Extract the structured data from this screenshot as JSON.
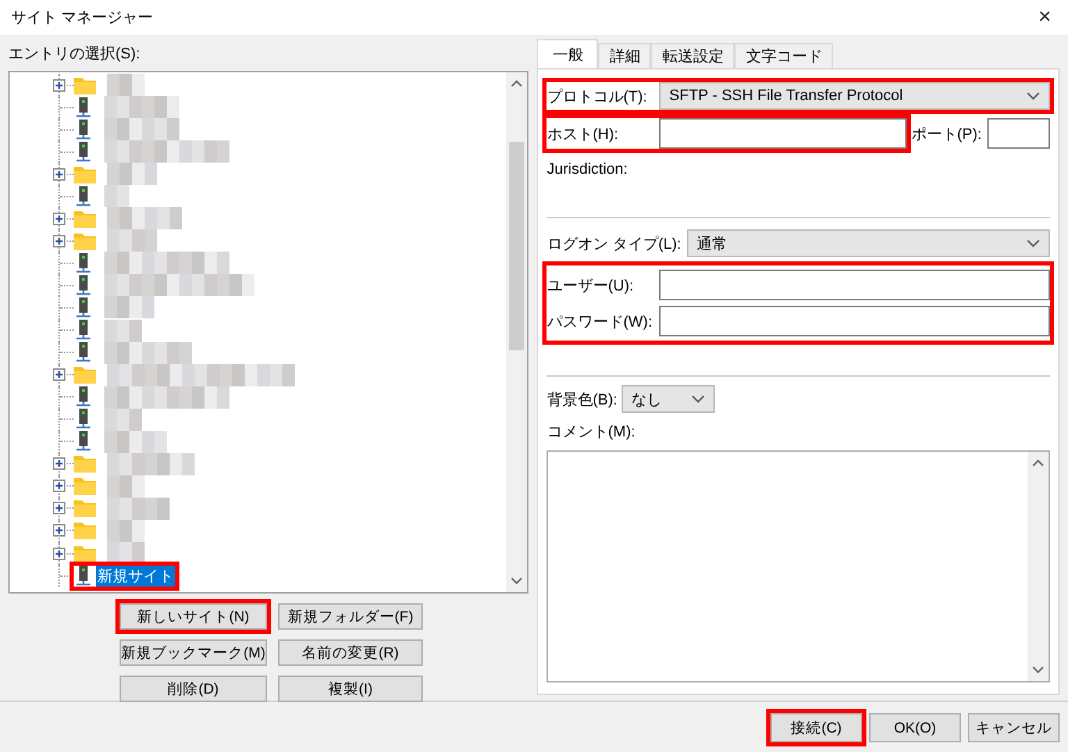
{
  "window": {
    "title": "サイト マネージャー",
    "close": "×"
  },
  "entries": {
    "label": "エントリの選択(S):",
    "items": [
      {
        "kind": "folder",
        "expanded": false,
        "selected": false,
        "highlighted": false
      },
      {
        "kind": "site",
        "selected": false,
        "highlighted": false
      },
      {
        "kind": "site",
        "selected": false,
        "highlighted": false
      },
      {
        "kind": "site",
        "selected": false,
        "highlighted": false
      },
      {
        "kind": "folder",
        "expanded": false,
        "selected": false,
        "highlighted": false
      },
      {
        "kind": "site",
        "selected": false,
        "highlighted": false
      },
      {
        "kind": "folder",
        "expanded": false,
        "selected": false,
        "highlighted": false
      },
      {
        "kind": "folder",
        "expanded": false,
        "selected": false,
        "highlighted": false
      },
      {
        "kind": "site",
        "selected": false,
        "highlighted": false
      },
      {
        "kind": "site",
        "selected": false,
        "highlighted": false
      },
      {
        "kind": "site",
        "selected": false,
        "highlighted": false
      },
      {
        "kind": "site",
        "selected": false,
        "highlighted": false
      },
      {
        "kind": "site",
        "selected": false,
        "highlighted": false
      },
      {
        "kind": "folder",
        "expanded": false,
        "selected": false,
        "highlighted": false
      },
      {
        "kind": "site",
        "selected": false,
        "highlighted": false
      },
      {
        "kind": "site",
        "selected": false,
        "highlighted": false
      },
      {
        "kind": "site",
        "selected": false,
        "highlighted": false
      },
      {
        "kind": "folder",
        "expanded": false,
        "selected": false,
        "highlighted": false
      },
      {
        "kind": "folder",
        "expanded": false,
        "selected": false,
        "highlighted": false
      },
      {
        "kind": "folder",
        "expanded": false,
        "selected": false,
        "highlighted": false
      },
      {
        "kind": "folder",
        "expanded": false,
        "selected": false,
        "highlighted": false
      },
      {
        "kind": "folder",
        "expanded": false,
        "selected": false,
        "highlighted": false
      },
      {
        "kind": "site",
        "label": "新規サイト",
        "selected": true,
        "highlighted": true
      }
    ],
    "buttons": [
      {
        "label": "新しいサイト(N)",
        "highlighted": true
      },
      {
        "label": "新規フォルダー(F)",
        "highlighted": false
      },
      {
        "label": "新規ブックマーク(M)",
        "highlighted": false
      },
      {
        "label": "名前の変更(R)",
        "highlighted": false
      },
      {
        "label": "削除(D)",
        "highlighted": false
      },
      {
        "label": "複製(I)",
        "highlighted": false
      }
    ]
  },
  "tabs": [
    {
      "label": "一般",
      "selected": true
    },
    {
      "label": "詳細",
      "selected": false
    },
    {
      "label": "転送設定",
      "selected": false
    },
    {
      "label": "文字コード",
      "selected": false
    }
  ],
  "general": {
    "protocol": {
      "label": "プロトコル(T):",
      "value": "SFTP - SSH File Transfer Protocol",
      "highlighted": true
    },
    "host": {
      "label": "ホスト(H):",
      "highlighted": true
    },
    "port": {
      "label": "ポート(P):"
    },
    "jurisdiction": {
      "label": "Jurisdiction:"
    },
    "logon_type": {
      "label": "ログオン タイプ(L):",
      "value": "通常"
    },
    "credentials": {
      "highlighted": true,
      "user": {
        "label": "ユーザー(U):"
      },
      "password": {
        "label": "パスワード(W):"
      }
    },
    "background_color": {
      "label": "背景色(B):",
      "value": "なし"
    },
    "comment": {
      "label": "コメント(M):"
    }
  },
  "dialog_buttons": [
    {
      "label": "接続(C)",
      "highlighted": true
    },
    {
      "label": "OK(O)",
      "highlighted": false
    },
    {
      "label": "キャンセル",
      "highlighted": false
    }
  ]
}
